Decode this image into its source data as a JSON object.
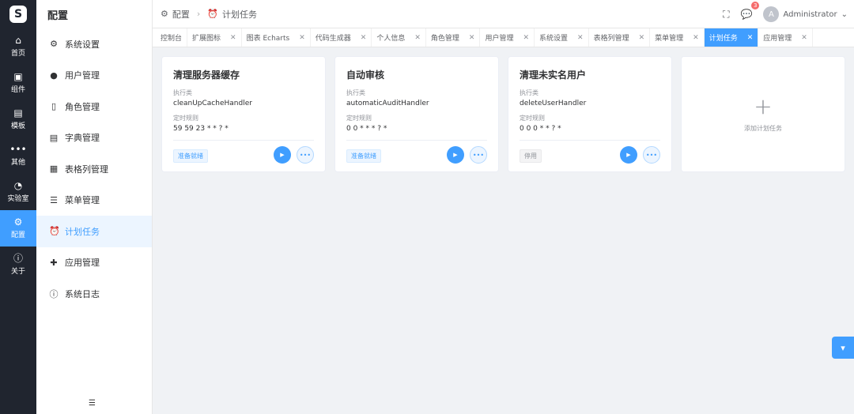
{
  "rail": {
    "logo": "S",
    "items": [
      {
        "label": "首页",
        "icon": "home-icon",
        "glyph": "⌂"
      },
      {
        "label": "组件",
        "icon": "component-icon",
        "glyph": "▣"
      },
      {
        "label": "模板",
        "icon": "template-icon",
        "glyph": "▤"
      },
      {
        "label": "其他",
        "icon": "more-icon",
        "glyph": "•••"
      },
      {
        "label": "实验室",
        "icon": "lab-icon",
        "glyph": "◔"
      },
      {
        "label": "配置",
        "icon": "config-icon",
        "glyph": "⚙"
      },
      {
        "label": "关于",
        "icon": "about-icon",
        "glyph": "ⓘ"
      }
    ]
  },
  "sidebar": {
    "title": "配置",
    "items": [
      {
        "label": "系统设置",
        "glyph": "⚙"
      },
      {
        "label": "用户管理",
        "glyph": "●"
      },
      {
        "label": "角色管理",
        "glyph": "▯"
      },
      {
        "label": "字典管理",
        "glyph": "▤"
      },
      {
        "label": "表格列管理",
        "glyph": "▦"
      },
      {
        "label": "菜单管理",
        "glyph": "☰"
      },
      {
        "label": "计划任务",
        "glyph": "⏰"
      },
      {
        "label": "应用管理",
        "glyph": "✚"
      },
      {
        "label": "系统日志",
        "glyph": "ⓘ"
      }
    ],
    "active_index": 6
  },
  "header": {
    "crumb_root": "配置",
    "crumb_current": "计划任务",
    "notif_count": "3",
    "avatar_letter": "A",
    "username": "Administrator"
  },
  "tabs": [
    {
      "label": "控制台",
      "closable": false
    },
    {
      "label": "扩展图标",
      "closable": true
    },
    {
      "label": "图表 Echarts",
      "closable": true
    },
    {
      "label": "代码生成器",
      "closable": true
    },
    {
      "label": "个人信息",
      "closable": true
    },
    {
      "label": "角色管理",
      "closable": true
    },
    {
      "label": "用户管理",
      "closable": true
    },
    {
      "label": "系统设置",
      "closable": true
    },
    {
      "label": "表格列管理",
      "closable": true
    },
    {
      "label": "菜单管理",
      "closable": true
    },
    {
      "label": "计划任务",
      "closable": true,
      "active": true
    },
    {
      "label": "应用管理",
      "closable": true
    }
  ],
  "labels": {
    "exec_class": "执行类",
    "cron_rule": "定时规则",
    "add_task": "添加计划任务"
  },
  "tasks": [
    {
      "title": "清理服务器缓存",
      "handler": "cleanUpCacheHandler",
      "cron": "59 59 23 * * ? *",
      "status": "准备就绪",
      "status_type": "ready"
    },
    {
      "title": "自动审核",
      "handler": "automaticAuditHandler",
      "cron": "0 0 * * * ? *",
      "status": "准备就绪",
      "status_type": "ready"
    },
    {
      "title": "清理未实名用户",
      "handler": "deleteUserHandler",
      "cron": "0 0 0 * * ? *",
      "status": "停用",
      "status_type": "off"
    }
  ],
  "colors": {
    "primary": "#409eff",
    "rail_bg": "#20252f"
  }
}
